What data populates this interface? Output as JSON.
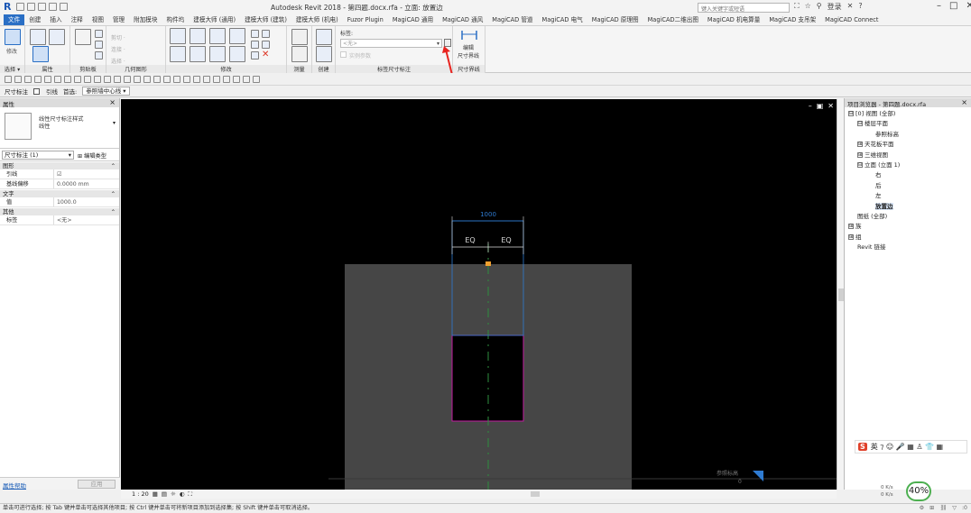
{
  "app": {
    "logo": "R",
    "title": "Autodesk Revit 2018 -   第四题.docx.rfa - 立面: 放置边",
    "search_placeholder": "键入关键字或短语",
    "user": "登录",
    "help": "?"
  },
  "tabs": [
    "文件",
    "创建",
    "插入",
    "注释",
    "视图",
    "管理",
    "附加模块",
    "构件坞",
    "建模大师 (通用)",
    "建模大师 (建筑)",
    "建模大师 (机电)",
    "Fuzor Plugin",
    "MagiCAD 通用",
    "MagiCAD 通风",
    "MagiCAD 管道",
    "MagiCAD 电气",
    "MagiCAD 原理图",
    "MagiCAD二维出图",
    "MagiCAD 机电算量",
    "MagiCAD 支吊架",
    "MagiCAD Connect"
  ],
  "ribbon": {
    "modify_label": "修改",
    "panels": [
      "选择",
      "属性",
      "剪贴板",
      "几何图形",
      "修改",
      "测量",
      "创建",
      "标签尺寸标注",
      "尺寸界线"
    ],
    "select_dropdown": "选择 ▾",
    "clip_items": [
      "剪切 ·",
      "连接 ·",
      "选择 ·"
    ],
    "label_title": "标签:",
    "label_value": "<无>",
    "instance_param": "实例参数",
    "edit_witness": "编辑\n尺寸界线",
    "edit_witness_line1": "编辑",
    "edit_witness_line2": "尺寸界线"
  },
  "options_bar": {
    "context": "尺寸标注",
    "leader_label": "引线",
    "prefer_label": "首选:",
    "prefer_value": "参照墙中心线"
  },
  "properties": {
    "title": "属性",
    "type_name_line1": "线性尺寸标注样式",
    "type_name_line2": "线性",
    "instance": "尺寸标注 (1)",
    "edit_type": "编辑类型",
    "groups": [
      {
        "name": "图形",
        "rows": [
          {
            "k": "引线",
            "v": "☑"
          },
          {
            "k": "基线偏移",
            "v": "0.0000 mm"
          }
        ]
      },
      {
        "name": "文字",
        "rows": [
          {
            "k": "值",
            "v": "1000.0"
          }
        ]
      },
      {
        "name": "其他",
        "rows": [
          {
            "k": "标签",
            "v": "<无>"
          }
        ]
      }
    ],
    "help_link": "属性帮助",
    "apply": "应用"
  },
  "canvas": {
    "dim_top": "1000",
    "eq_left": "EQ",
    "eq_right": "EQ",
    "ref_label": "参照标高",
    "ref_value": "0",
    "colors": {
      "bg": "#000000",
      "box": "#464646",
      "dim": "#2f7bd1",
      "magenta": "#c21aa0",
      "green": "#2f8f3f"
    }
  },
  "view_control": {
    "scale": "1 : 20"
  },
  "browser": {
    "title": "项目浏览器 - 第四题.docx.rfa",
    "items": [
      {
        "lvl": 0,
        "exp": "⊟",
        "text": "[0] 视图 (全部)"
      },
      {
        "lvl": 1,
        "exp": "⊟",
        "text": "楼层平面"
      },
      {
        "lvl": 2,
        "exp": "",
        "text": "参照标高"
      },
      {
        "lvl": 1,
        "exp": "⊞",
        "text": "天花板平面"
      },
      {
        "lvl": 1,
        "exp": "⊞",
        "text": "三维视图"
      },
      {
        "lvl": 1,
        "exp": "⊟",
        "text": "立面 (立面 1)"
      },
      {
        "lvl": 2,
        "exp": "",
        "text": "右"
      },
      {
        "lvl": 2,
        "exp": "",
        "text": "后"
      },
      {
        "lvl": 2,
        "exp": "",
        "text": "左"
      },
      {
        "lvl": 2,
        "exp": "",
        "text": "放置边",
        "sel": true
      },
      {
        "lvl": 0,
        "exp": "",
        "text": "图纸 (全部)"
      },
      {
        "lvl": 0,
        "exp": "⊞",
        "text": "族"
      },
      {
        "lvl": 0,
        "exp": "⊞",
        "text": "组"
      },
      {
        "lvl": 0,
        "exp": "",
        "text": "Revit 链接"
      }
    ]
  },
  "ime": {
    "brand": "S",
    "text": "英 ⁊ ☺ 🎤 ▦ ♙ 👕 ▦"
  },
  "netspeed": {
    "up": "0 K/s",
    "down": "0 K/s"
  },
  "zoom": "40%",
  "status": {
    "text": "单击可进行选择; 按 Tab 键并单击可选择其他项目; 按 Ctrl 键并单击可将新项目添加到选择集; 按 Shift 键并单击可取消选择。",
    "right": ":0"
  }
}
